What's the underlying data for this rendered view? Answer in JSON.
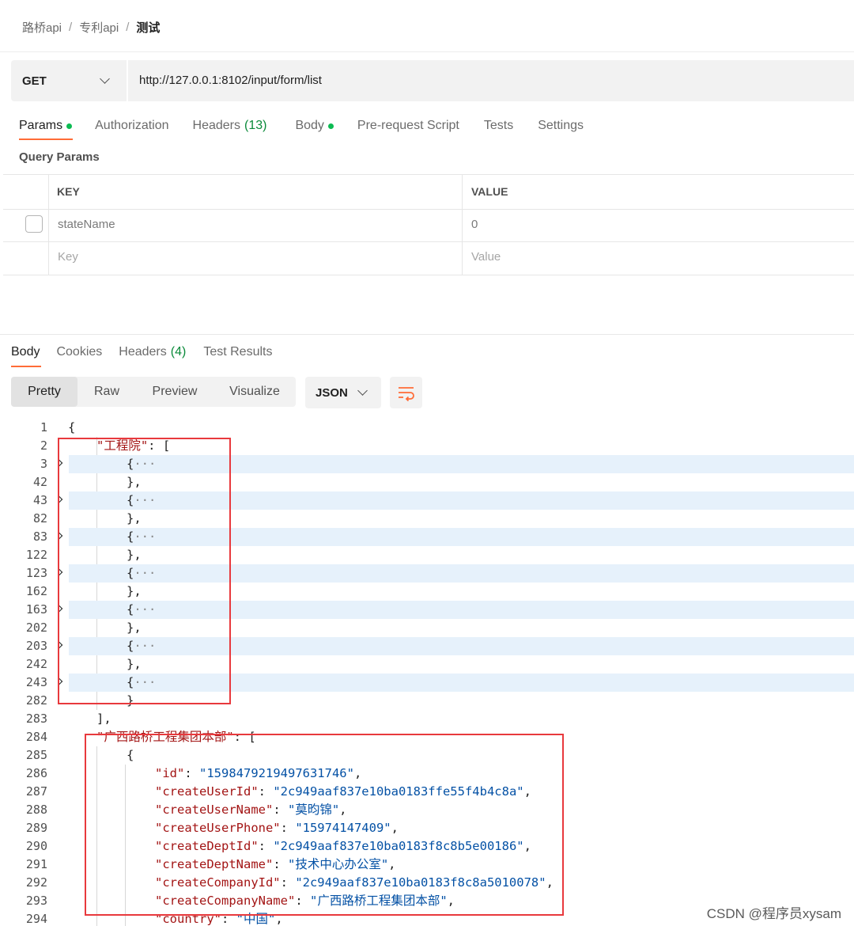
{
  "breadcrumb": {
    "items": [
      "路桥api",
      "专利api"
    ],
    "current": "测试",
    "separator": "/"
  },
  "request": {
    "method": "GET",
    "url": "http://127.0.0.1:8102/input/form/list"
  },
  "request_tabs": {
    "params": "Params",
    "authorization": "Authorization",
    "headers": "Headers",
    "headers_count": "(13)",
    "body": "Body",
    "prerequest": "Pre-request Script",
    "tests": "Tests",
    "settings": "Settings"
  },
  "query_params": {
    "title": "Query Params",
    "col_key": "KEY",
    "col_value": "VALUE",
    "rows": [
      {
        "key": "stateName",
        "value": "0",
        "checked": false
      }
    ],
    "key_placeholder": "Key",
    "value_placeholder": "Value"
  },
  "response_tabs": {
    "body": "Body",
    "cookies": "Cookies",
    "headers": "Headers",
    "headers_count": "(4)",
    "test_results": "Test Results"
  },
  "view": {
    "pretty": "Pretty",
    "raw": "Raw",
    "preview": "Preview",
    "visualize": "Visualize",
    "format": "JSON"
  },
  "code": {
    "lines": [
      {
        "n": "1"
      },
      {
        "n": "2"
      },
      {
        "n": "3"
      },
      {
        "n": "42"
      },
      {
        "n": "43"
      },
      {
        "n": "82"
      },
      {
        "n": "83"
      },
      {
        "n": "122"
      },
      {
        "n": "123"
      },
      {
        "n": "162"
      },
      {
        "n": "163"
      },
      {
        "n": "202"
      },
      {
        "n": "203"
      },
      {
        "n": "242"
      },
      {
        "n": "243"
      },
      {
        "n": "282"
      },
      {
        "n": "283"
      },
      {
        "n": "284"
      },
      {
        "n": "285"
      },
      {
        "n": "286"
      },
      {
        "n": "287"
      },
      {
        "n": "288"
      },
      {
        "n": "289"
      },
      {
        "n": "290"
      },
      {
        "n": "291"
      },
      {
        "n": "292"
      },
      {
        "n": "293"
      },
      {
        "n": "294"
      }
    ],
    "open_brace": "{",
    "group1_key": "\"工程院\"",
    "group2_key": "\"广西路桥工程集团本部\"",
    "fields": [
      {
        "key": "\"id\"",
        "value": "\"1598479219497631746\""
      },
      {
        "key": "\"createUserId\"",
        "value": "\"2c949aaf837e10ba0183ffe55f4b4c8a\""
      },
      {
        "key": "\"createUserName\"",
        "value": "\"莫昀锦\""
      },
      {
        "key": "\"createUserPhone\"",
        "value": "\"15974147409\""
      },
      {
        "key": "\"createDeptId\"",
        "value": "\"2c949aaf837e10ba0183f8c8b5e00186\""
      },
      {
        "key": "\"createDeptName\"",
        "value": "\"技术中心办公室\""
      },
      {
        "key": "\"createCompanyId\"",
        "value": "\"2c949aaf837e10ba0183f8c8a5010078\""
      },
      {
        "key": "\"createCompanyName\"",
        "value": "\"广西路桥工程集团本部\""
      },
      {
        "key": "\"country\"",
        "value": "\"中国\""
      }
    ]
  },
  "watermark": "CSDN @程序员xysam"
}
